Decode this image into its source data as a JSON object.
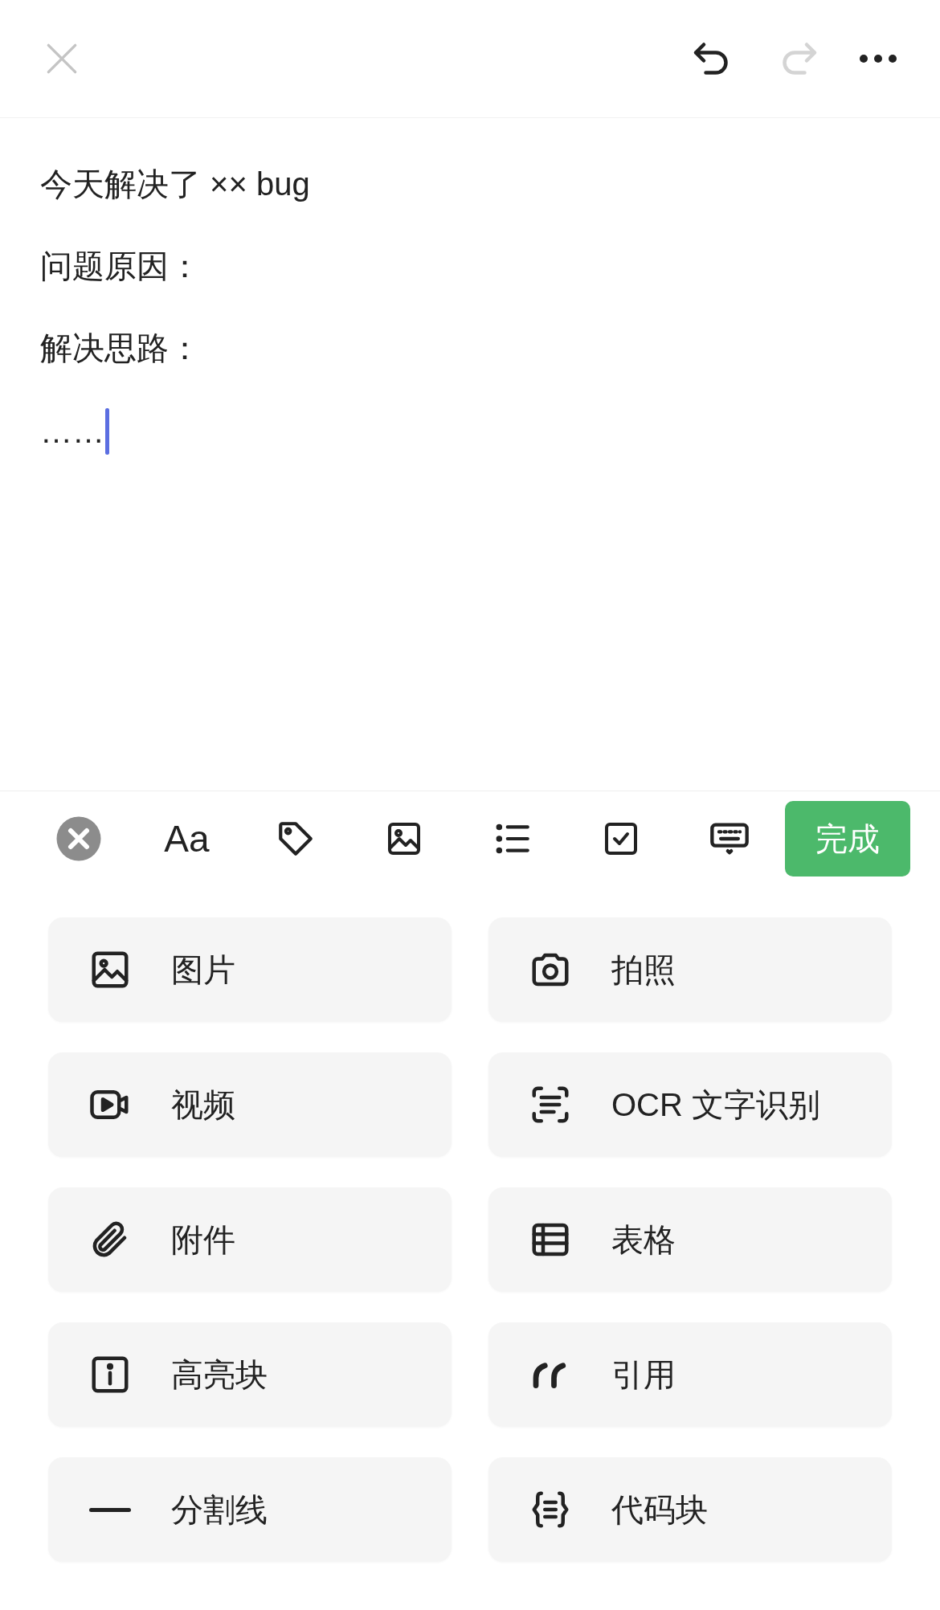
{
  "header": {
    "undo_disabled": false,
    "redo_disabled": true
  },
  "note": {
    "lines": [
      "今天解决了 ×× bug",
      "问题原因：",
      "解决思路：",
      "……"
    ]
  },
  "toolbar": {
    "format_label": "Aa",
    "done": "完成",
    "tools": [
      {
        "kind": "clear"
      },
      {
        "kind": "format"
      },
      {
        "kind": "tag"
      },
      {
        "kind": "image"
      },
      {
        "kind": "list"
      },
      {
        "kind": "todo"
      },
      {
        "kind": "keyboard"
      }
    ]
  },
  "insert_menu": [
    {
      "kind": "image",
      "label": "图片"
    },
    {
      "kind": "camera",
      "label": "拍照"
    },
    {
      "kind": "video",
      "label": "视频"
    },
    {
      "kind": "ocr",
      "label": "OCR 文字识别"
    },
    {
      "kind": "attachment",
      "label": "附件"
    },
    {
      "kind": "table",
      "label": "表格"
    },
    {
      "kind": "highlight",
      "label": "高亮块"
    },
    {
      "kind": "quote",
      "label": "引用"
    },
    {
      "kind": "divider",
      "label": "分割线"
    },
    {
      "kind": "code",
      "label": "代码块"
    }
  ]
}
